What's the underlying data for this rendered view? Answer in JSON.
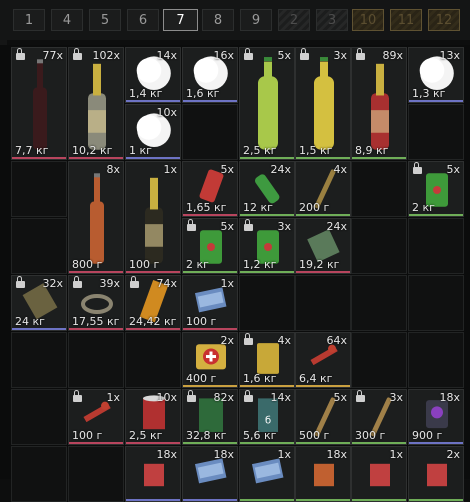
{
  "tabs": [
    {
      "label": "1"
    },
    {
      "label": "4"
    },
    {
      "label": "5"
    },
    {
      "label": "6"
    },
    {
      "label": "7"
    },
    {
      "label": "8"
    },
    {
      "label": "9"
    },
    {
      "label": "2"
    },
    {
      "label": "3"
    },
    {
      "label": "10"
    },
    {
      "label": "11"
    },
    {
      "label": "12"
    }
  ],
  "active_tab": "7",
  "items": [
    {
      "name": "dark-wine-bottle",
      "count": "77x",
      "weight": "7,7 кг",
      "locked": true
    },
    {
      "name": "champagne-bottle-silver",
      "count": "102x",
      "weight": "10,2 кг",
      "locked": true
    },
    {
      "name": "snowball-1",
      "count": "14x",
      "weight": "1,4 кг",
      "locked": false
    },
    {
      "name": "snowball-2",
      "count": "16x",
      "weight": "1,6 кг",
      "locked": false
    },
    {
      "name": "green-juice-bottle",
      "count": "5x",
      "weight": "2,5 кг",
      "locked": true
    },
    {
      "name": "yellow-juice-bottle",
      "count": "3x",
      "weight": "1,5 кг",
      "locked": true
    },
    {
      "name": "champagne-bottle-red",
      "count": "89x",
      "weight": "8,9 кг",
      "locked": true
    },
    {
      "name": "snowball-3",
      "count": "13x",
      "weight": "1,3 кг",
      "locked": false
    },
    {
      "name": "snowball-4",
      "count": "10x",
      "weight": "1 кг",
      "locked": false
    },
    {
      "name": "cola-bottle",
      "count": "8x",
      "weight": "800 г",
      "locked": false
    },
    {
      "name": "champagne-bottle-gold",
      "count": "1x",
      "weight": "100 г",
      "locked": false
    },
    {
      "name": "red-can",
      "count": "5x",
      "weight": "1,65 кг",
      "locked": false
    },
    {
      "name": "green-bottle",
      "count": "24x",
      "weight": "12 кг",
      "locked": false
    },
    {
      "name": "wooden-stick",
      "count": "4x",
      "weight": "200 г",
      "locked": false
    },
    {
      "name": "green-jerrycan-1",
      "count": "5x",
      "weight": "2 кг",
      "locked": true
    },
    {
      "name": "green-jerrycan-2",
      "count": "5x",
      "weight": "2 кг",
      "locked": true
    },
    {
      "name": "green-jerrycan-3",
      "count": "3x",
      "weight": "1,2 кг",
      "locked": true
    },
    {
      "name": "ration-pack",
      "count": "24x",
      "weight": "19,2 кг",
      "locked": false
    },
    {
      "name": "brown-bag",
      "count": "32x",
      "weight": "24 кг",
      "locked": true
    },
    {
      "name": "rope-coil",
      "count": "39x",
      "weight": "17,55 кг",
      "locked": true
    },
    {
      "name": "golden-bag",
      "count": "74x",
      "weight": "24,42 кг",
      "locked": true
    },
    {
      "name": "blue-cards",
      "count": "1x",
      "weight": "100 г",
      "locked": false
    },
    {
      "name": "medkit",
      "count": "2x",
      "weight": "400 г",
      "locked": false
    },
    {
      "name": "yellow-box",
      "count": "4x",
      "weight": "1,6 кг",
      "locked": true
    },
    {
      "name": "red-tool-1",
      "count": "64x",
      "weight": "6,4 кг",
      "locked": false
    },
    {
      "name": "red-tool-2",
      "count": "1x",
      "weight": "100 г",
      "locked": true
    },
    {
      "name": "tin-can",
      "count": "10x",
      "weight": "2,5 кг",
      "locked": false
    },
    {
      "name": "green-pack",
      "count": "82x",
      "weight": "32,8 кг",
      "locked": true
    },
    {
      "name": "chips-pack",
      "count": "14x",
      "weight": "5,6 кг",
      "locked": true
    },
    {
      "name": "wooden-bat-1",
      "count": "5x",
      "weight": "500 г",
      "locked": false
    },
    {
      "name": "wooden-bat-2",
      "count": "3x",
      "weight": "300 г",
      "locked": true
    },
    {
      "name": "purple-box",
      "count": "18x",
      "weight": "900 г",
      "locked": false
    },
    {
      "name": "bottom-item-1",
      "count": "18x",
      "weight": "",
      "locked": false
    },
    {
      "name": "bottom-item-2",
      "count": "18x",
      "weight": "",
      "locked": false
    },
    {
      "name": "bottom-item-3",
      "count": "1x",
      "weight": "",
      "locked": false
    },
    {
      "name": "bottom-item-4",
      "count": "18x",
      "weight": "",
      "locked": false
    },
    {
      "name": "bottom-item-5",
      "count": "1x",
      "weight": "",
      "locked": false
    },
    {
      "name": "bottom-item-6",
      "count": "2x",
      "weight": "",
      "locked": false
    }
  ]
}
